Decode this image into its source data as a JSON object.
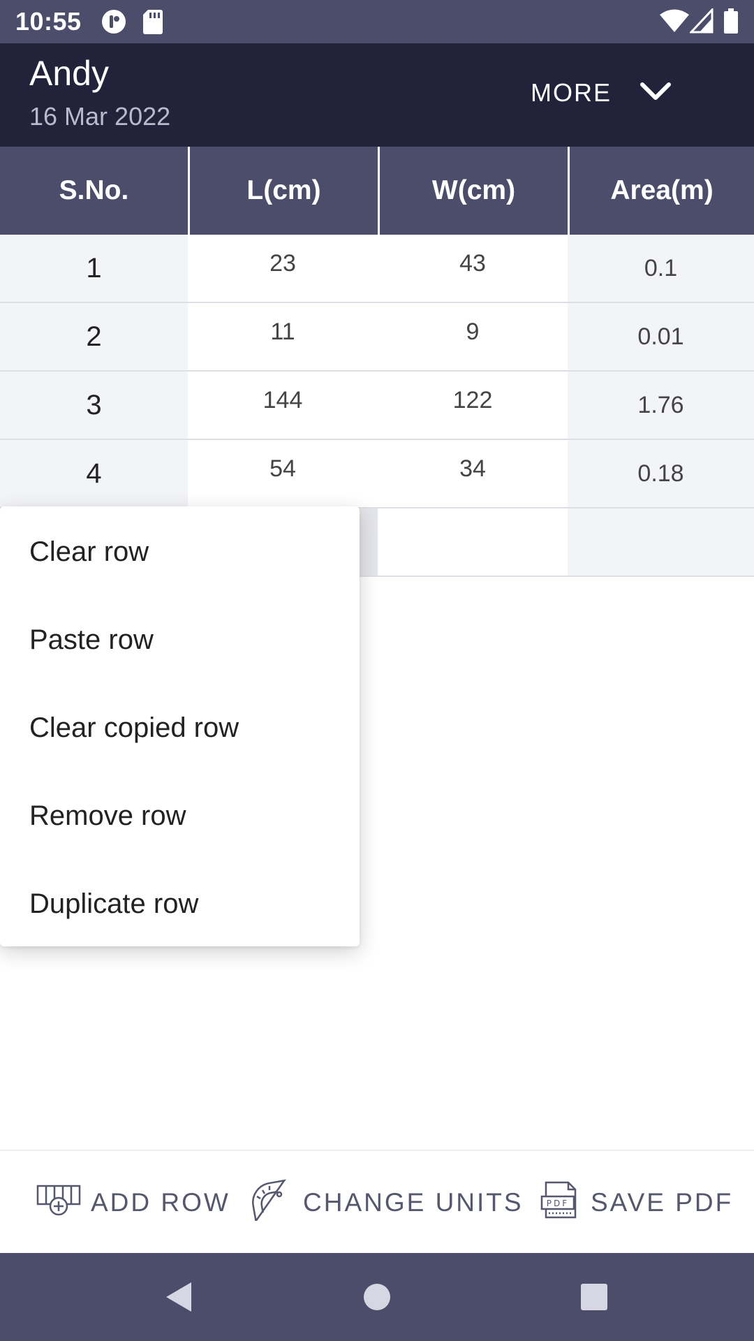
{
  "status_bar": {
    "time": "10:55",
    "left_icons": [
      "podcast-icon",
      "sd-card-icon"
    ],
    "right_icons": [
      "wifi-icon",
      "signal-icon",
      "battery-icon"
    ]
  },
  "header": {
    "title": "Andy",
    "date": "16 Mar 2022",
    "more_label": "MORE"
  },
  "table": {
    "columns": [
      "S.No.",
      "L(cm)",
      "W(cm)",
      "Area(m)"
    ],
    "rows": [
      {
        "sno": "1",
        "length": "23",
        "width": "43",
        "area": "0.1"
      },
      {
        "sno": "2",
        "length": "11",
        "width": "9",
        "area": "0.01"
      },
      {
        "sno": "3",
        "length": "144",
        "width": "122",
        "area": "1.76"
      },
      {
        "sno": "4",
        "length": "54",
        "width": "34",
        "area": "0.18"
      },
      {
        "sno": "",
        "length": "",
        "width": "",
        "area": ""
      }
    ]
  },
  "context_menu": {
    "items": [
      "Clear row",
      "Paste row",
      "Clear copied row",
      "Remove row",
      "Duplicate row"
    ]
  },
  "toolbar": {
    "add_row": "ADD ROW",
    "change_units": "CHANGE UNITS",
    "save_pdf": "SAVE PDF"
  },
  "nav": {
    "icons": [
      "back-icon",
      "home-icon",
      "recents-icon"
    ]
  },
  "colors": {
    "header_bg": "#22223a",
    "bar_bg": "#4b4d6a",
    "toolbar_text": "#55576c"
  }
}
